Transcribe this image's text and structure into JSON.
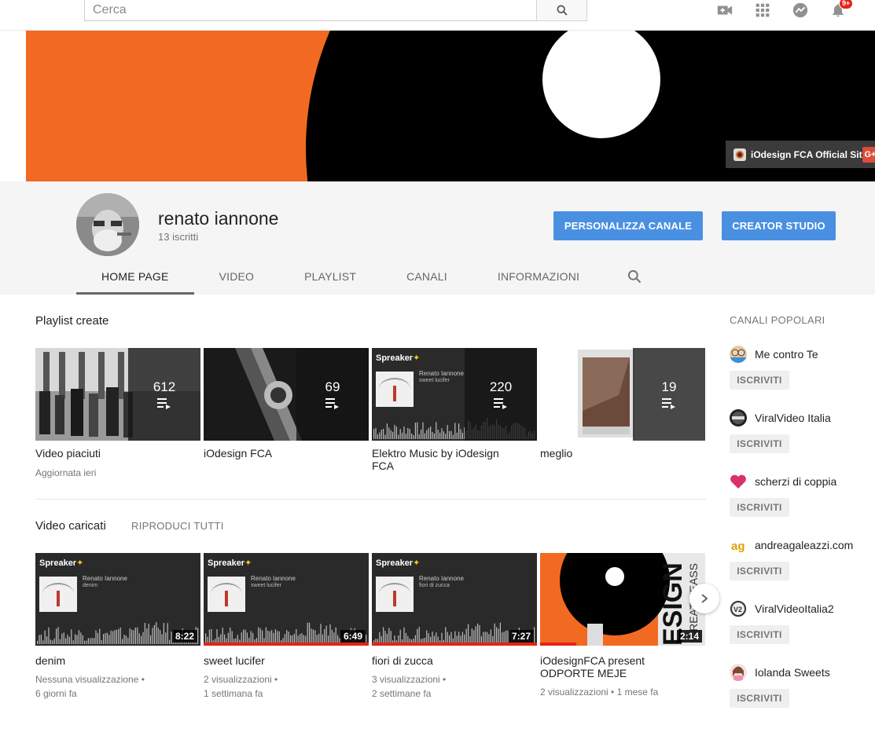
{
  "search": {
    "placeholder": "Cerca"
  },
  "masthead": {
    "notifications_badge": "9+"
  },
  "banner": {
    "link_label": "iOdesign FCA Official Site",
    "gplus_label": "G+"
  },
  "channel": {
    "name": "renato iannone",
    "subscribers": "13 iscritti",
    "customize_button": "PERSONALIZZA CANALE",
    "studio_button": "CREATOR STUDIO"
  },
  "tabs": [
    {
      "label": "HOME PAGE",
      "active": true
    },
    {
      "label": "VIDEO"
    },
    {
      "label": "PLAYLIST"
    },
    {
      "label": "CANALI"
    },
    {
      "label": "INFORMAZIONI"
    }
  ],
  "playlists_section": {
    "title": "Playlist create",
    "items": [
      {
        "title": "Video piaciuti",
        "count": "612",
        "meta": "Aggiornata ieri"
      },
      {
        "title": "iOdesign FCA",
        "count": "69",
        "meta": ""
      },
      {
        "title": "Elektro Music by iOdesign FCA",
        "count": "220",
        "meta": "",
        "thumb_title": "Renato Iannone",
        "thumb_sub": "sweet lucifer"
      },
      {
        "title": "meglio",
        "count": "19",
        "meta": ""
      }
    ]
  },
  "uploads_section": {
    "title": "Video caricati",
    "play_all": "RIPRODUCI TUTTI",
    "items": [
      {
        "title": "denim",
        "duration": "8:22",
        "views": "Nessuna visualizzazione",
        "age": "6 giorni fa",
        "thumb_title": "Renato Iannone",
        "thumb_sub": "denim",
        "progress": 0
      },
      {
        "title": "sweet lucifer",
        "duration": "6:49",
        "views": "2 visualizzazioni",
        "age": "1 settimana fa",
        "thumb_title": "Renato Iannone",
        "thumb_sub": "sweet lucifer",
        "progress": 1.0
      },
      {
        "title": "fiori di zucca",
        "duration": "7:27",
        "views": "3 visualizzazioni",
        "age": "2 settimane fa",
        "thumb_title": "Renato Iannone",
        "thumb_sub": "fiori di zucca",
        "progress": 1.0
      },
      {
        "title": "iOdesignFCA present ODPORTE MEJE",
        "duration": "2:14",
        "views": "2 visualizzazioni",
        "age": "1 mese fa",
        "progress": 0.22
      }
    ]
  },
  "spreaker_logo": "Spreaker",
  "sidebar": {
    "title": "CANALI POPOLARI",
    "subscribe_label": "ISCRIVITI",
    "channels": [
      {
        "name": "Me contro Te"
      },
      {
        "name": "ViralVideo Italia"
      },
      {
        "name": "scherzi di coppia"
      },
      {
        "name": "andreagaleazzi.com"
      },
      {
        "name": "ViralVideoItalia2"
      },
      {
        "name": "Iolanda Sweets"
      }
    ]
  },
  "colors": {
    "accent_blue": "#4a90e2",
    "youtube_red": "#e62117",
    "banner_orange": "#f26a21"
  }
}
